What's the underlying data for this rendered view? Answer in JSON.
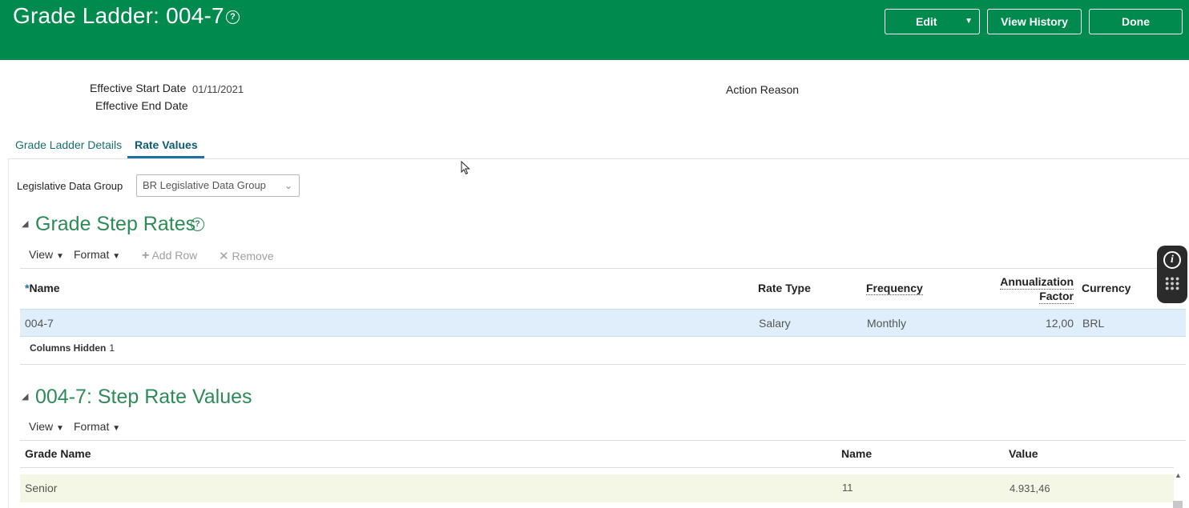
{
  "header": {
    "title": "Grade Ladder: 004-7",
    "help_icon": "?",
    "edit_label": "Edit",
    "view_history_label": "View History",
    "done_label": "Done"
  },
  "fields": {
    "effective_start_label": "Effective Start Date",
    "effective_start_value": "01/11/2021",
    "effective_end_label": "Effective End Date",
    "action_reason_label": "Action Reason"
  },
  "tabs": [
    {
      "label": "Grade Ladder Details",
      "active": false
    },
    {
      "label": "Rate Values",
      "active": true
    }
  ],
  "ldg": {
    "label": "Legislative Data Group",
    "value": "BR Legislative Data Group"
  },
  "grade_step_rates": {
    "title": "Grade Step Rates",
    "toolbar": {
      "view": "View",
      "format": "Format",
      "add_row": "Add Row",
      "remove": "Remove"
    },
    "columns": {
      "required_marker": "*",
      "name": "Name",
      "rate_type": "Rate Type",
      "frequency": "Frequency",
      "annualization_1": "Annualization",
      "annualization_2": "Factor",
      "currency": "Currency"
    },
    "rows": [
      {
        "name": "004-7",
        "rate_type": "Salary",
        "frequency": "Monthly",
        "annualization_factor": "12,00",
        "currency": "BRL"
      }
    ],
    "columns_hidden_label": "Columns Hidden",
    "columns_hidden_count": "1"
  },
  "step_rate_values": {
    "title": "004-7: Step Rate Values",
    "toolbar": {
      "view": "View",
      "format": "Format"
    },
    "columns": {
      "grade_name": "Grade Name",
      "name": "Name",
      "value": "Value"
    },
    "rows": [
      {
        "grade_name": "Senior",
        "name": "11",
        "value": "4.931,46"
      }
    ]
  },
  "icons": {
    "help": "help-circle-icon",
    "caret": "caret-down-icon",
    "collapse": "collapse-triangle-icon",
    "add": "plus-icon",
    "remove": "x-icon",
    "info": "info-icon",
    "grid": "dots-grid-icon"
  },
  "colors": {
    "header_bg": "#008a4e",
    "section_title": "#2e8b57",
    "selected_row": "#dfeefa",
    "tab_active_underline": "#1f6fa8"
  }
}
